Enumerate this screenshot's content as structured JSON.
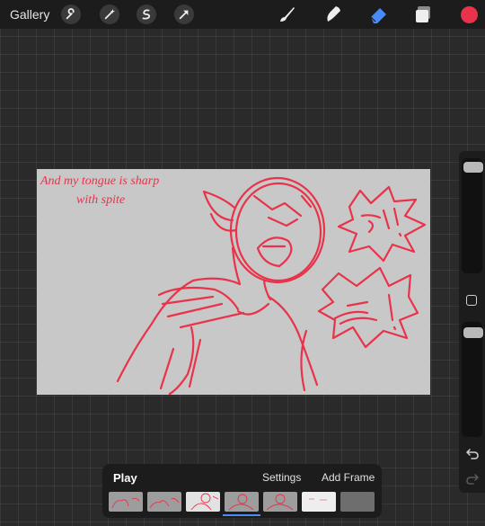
{
  "topbar": {
    "gallery_label": "Gallery",
    "tools": [
      {
        "name": "wrench-icon"
      },
      {
        "name": "magic-wand-icon"
      },
      {
        "name": "selection-icon"
      },
      {
        "name": "transform-arrow-icon"
      }
    ],
    "right_tools": [
      {
        "name": "brush-icon"
      },
      {
        "name": "smudge-icon"
      },
      {
        "name": "eraser-icon"
      },
      {
        "name": "layers-icon"
      }
    ],
    "active_tool": "eraser-icon",
    "eraser_color": "#4a8cf7",
    "current_color": "#e8334a"
  },
  "canvas": {
    "caption_line1": "And my tongue is sharp",
    "caption_line2": "with spite",
    "sketch_color": "#e8334a",
    "background": "#c8c8c8"
  },
  "sidebar": {
    "brush_size_level": 0.95,
    "opacity_level": 0.95,
    "icons": [
      "modify-square-icon",
      "undo-icon",
      "redo-icon"
    ]
  },
  "animation": {
    "play_label": "Play",
    "settings_label": "Settings",
    "add_frame_label": "Add Frame",
    "frames": [
      "frame-1",
      "frame-2",
      "frame-3",
      "frame-4",
      "frame-5",
      "frame-6",
      "frame-7"
    ],
    "active_frame": 3
  }
}
